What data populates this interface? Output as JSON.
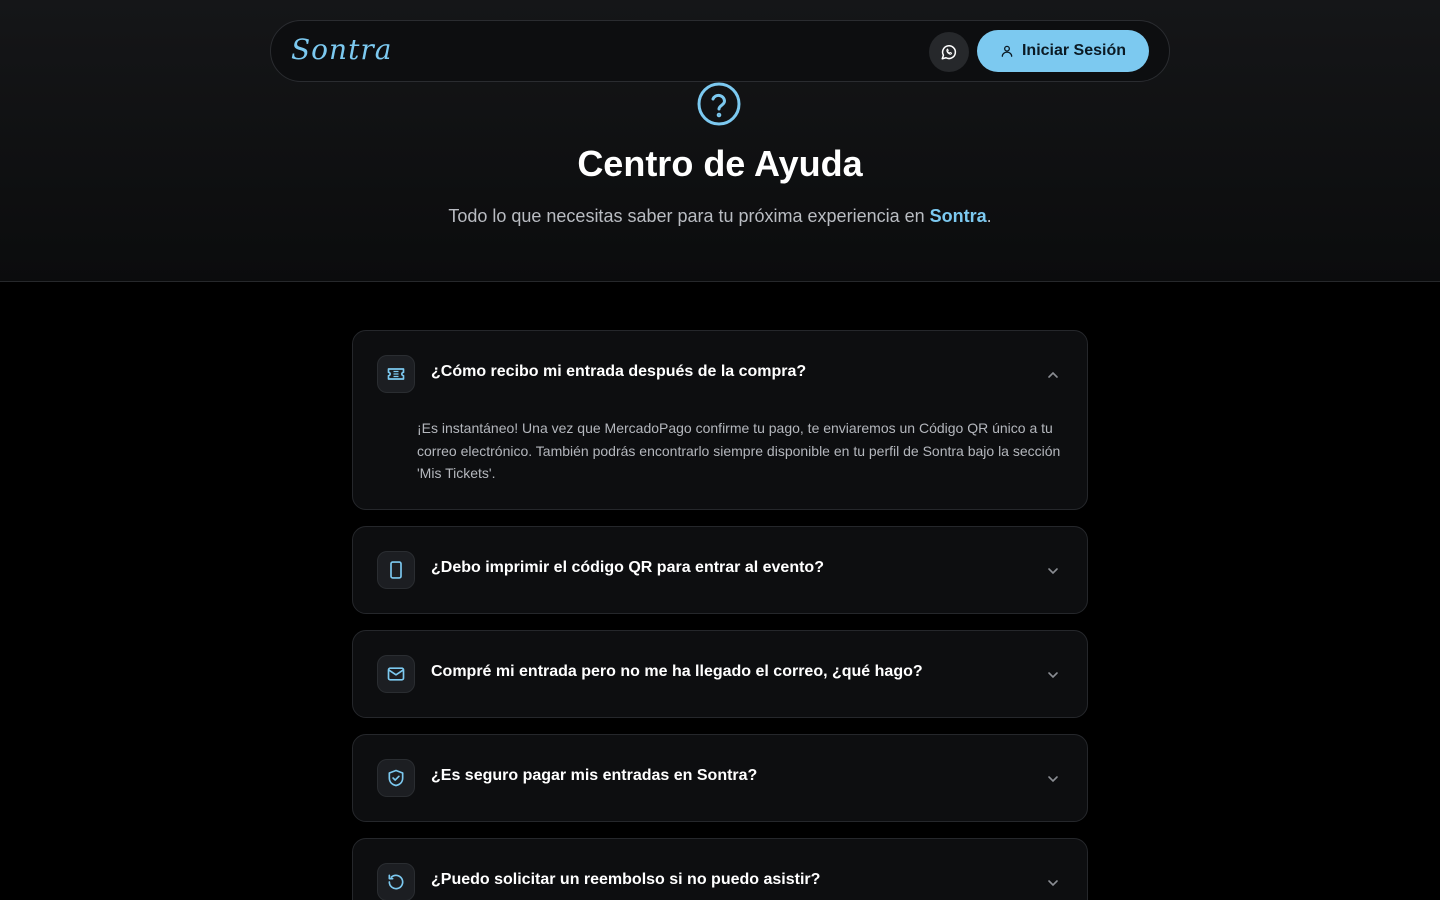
{
  "nav": {
    "logo": "Sontra",
    "login_label": "Iniciar Sesión"
  },
  "hero": {
    "title": "Centro de Ayuda",
    "subtitle_prefix": "Todo lo que necesitas saber para tu próxima experiencia en ",
    "subtitle_brand": "Sontra",
    "subtitle_suffix": "."
  },
  "faq": [
    {
      "icon": "ticket-icon",
      "question": "¿Cómo recibo mi entrada después de la compra?",
      "expanded": true,
      "answer": "¡Es instantáneo! Una vez que MercadoPago confirme tu pago, te enviaremos un Código QR único a tu correo electrónico. También podrás encontrarlo siempre disponible en tu perfil de Sontra bajo la sección 'Mis Tickets'."
    },
    {
      "icon": "smartphone-icon",
      "question": "¿Debo imprimir el código QR para entrar al evento?",
      "expanded": false
    },
    {
      "icon": "mail-icon",
      "question": "Compré mi entrada pero no me ha llegado el correo, ¿qué hago?",
      "expanded": false
    },
    {
      "icon": "shield-check-icon",
      "question": "¿Es seguro pagar mis entradas en Sontra?",
      "expanded": false
    },
    {
      "icon": "refund-icon",
      "question": "¿Puedo solicitar un reembolso si no puedo asistir?",
      "expanded": false
    }
  ],
  "colors": {
    "accent": "#7cc9f0",
    "background": "#000000",
    "card": "#0d0e10"
  }
}
